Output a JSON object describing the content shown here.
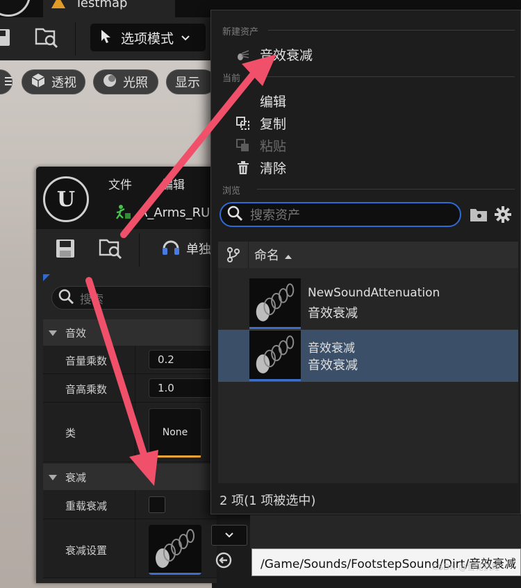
{
  "editor": {
    "map_tab": "Testmap",
    "mode_button": "选项模式",
    "viewport_buttons": [
      "透视",
      "光照",
      "显示"
    ]
  },
  "cue_editor": {
    "menu": [
      "文件",
      "编辑"
    ],
    "asset_tab": "A_Arms_RU",
    "play_button": "单独",
    "search_placeholder": "搜索",
    "sections": {
      "sound": "音效",
      "attenuation": "衰减"
    },
    "properties": {
      "volume_label": "音量乘数",
      "volume_value": "0.2",
      "pitch_label": "音高乘数",
      "pitch_value": "1.0",
      "class_label": "类",
      "class_value": "None",
      "override_label": "重载衰减",
      "settings_label": "衰减设置"
    }
  },
  "picker": {
    "new_asset_label": "新建资产",
    "new_sound_attenuation": "音效衰减",
    "current_label": "当前",
    "edit": "编辑",
    "copy": "复制",
    "paste": "粘贴",
    "clear": "清除",
    "browse_label": "浏览",
    "search_placeholder": "搜索资产",
    "column_name": "命名",
    "assets": [
      {
        "name": "NewSoundAttenuation",
        "type": "音效衰减",
        "selected": false
      },
      {
        "name": "音效衰减",
        "type": "音效衰减",
        "selected": true
      }
    ],
    "count_text": "2 项(1 项被选中)"
  },
  "tooltip": {
    "path": "/Game/Sounds/FootstepSound/Dirt/音效衰减"
  },
  "watermark": "CSDN @雪花抗睡",
  "colors": {
    "accent_blue": "#2f6bd6",
    "selected_row": "#3b5068",
    "arrow": "#f0506a",
    "class_underline": "#e8a33a"
  }
}
